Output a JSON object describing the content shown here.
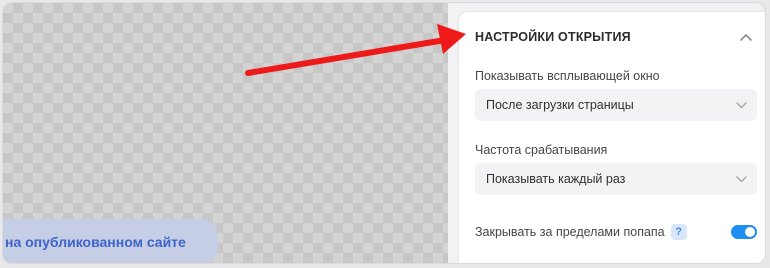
{
  "canvas": {
    "published_label": "на опубликованном сайте"
  },
  "panel": {
    "section_title": "НАСТРОЙКИ ОТКРЫТИЯ",
    "collapse_icon": "chevron-up-icon",
    "show_popup": {
      "label": "Показывать всплывающей окно",
      "value": "После загрузки страницы"
    },
    "frequency": {
      "label": "Частота срабатывания",
      "value": "Показывать каждый раз"
    },
    "close_outside": {
      "label": "Закрывать за пределами попапа",
      "help": "?",
      "enabled": true
    }
  },
  "colors": {
    "accent": "#1e8ef0",
    "annotation_arrow": "#ee1a1a",
    "pill_text": "#3e63c9"
  }
}
